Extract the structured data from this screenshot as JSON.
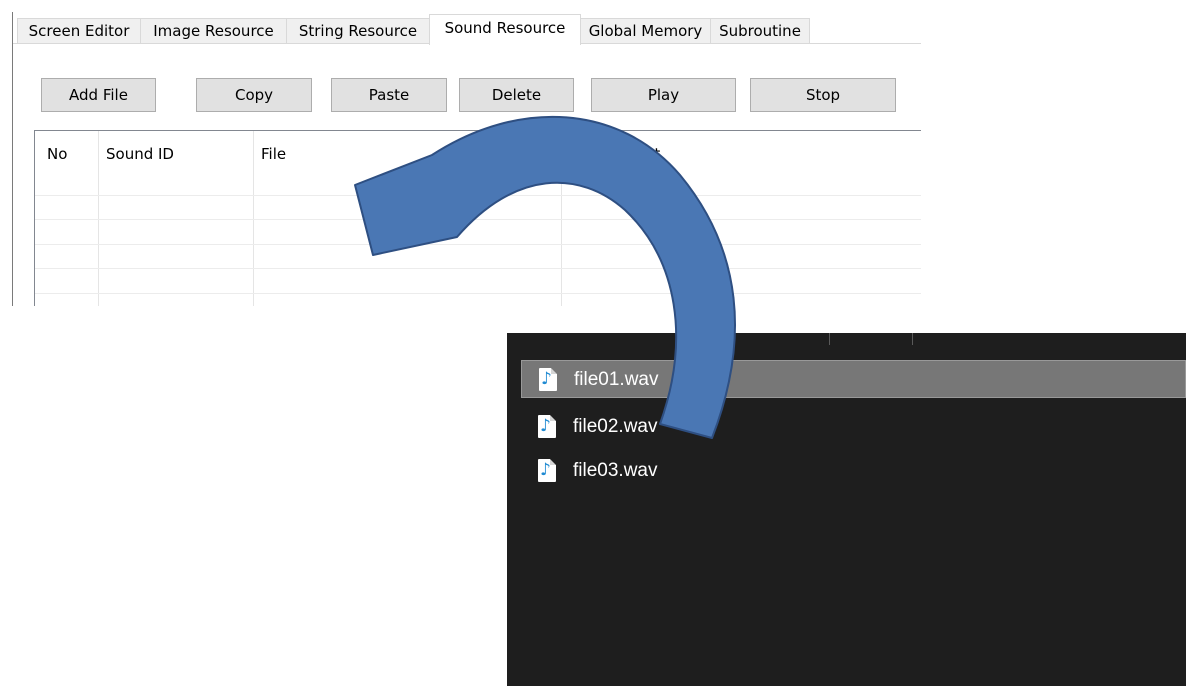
{
  "tabs": [
    {
      "label": "Screen Editor"
    },
    {
      "label": "Image Resource"
    },
    {
      "label": "String Resource"
    },
    {
      "label": "Sound Resource",
      "active": true
    },
    {
      "label": "Global Memory"
    },
    {
      "label": "Subroutine"
    }
  ],
  "toolbar": {
    "add_file": "Add File",
    "copy": "Copy",
    "paste": "Paste",
    "delete": "Delete",
    "play": "Play",
    "stop": "Stop"
  },
  "table": {
    "columns": [
      "No",
      "Sound ID",
      "File",
      "Comment"
    ],
    "visible_comment_fragment": "ment",
    "rows": []
  },
  "explorer": {
    "files": [
      {
        "name": "file01.wav",
        "selected": true,
        "icon": "audio-file-icon"
      },
      {
        "name": "file02.wav",
        "selected": false,
        "icon": "audio-file-icon"
      },
      {
        "name": "file03.wav",
        "selected": false,
        "icon": "audio-file-icon"
      }
    ]
  },
  "overlay": {
    "icon": "curved-arrow-icon",
    "meaning": "drag file from explorer into sound list",
    "fill_color": "#4a77b4",
    "stroke_color": "#2e4f82"
  },
  "colors": {
    "explorer_bg": "#1e1e1e",
    "selection_bg": "#777777",
    "button_bg": "#e1e1e1",
    "tab_bg": "#f0f0f0"
  }
}
